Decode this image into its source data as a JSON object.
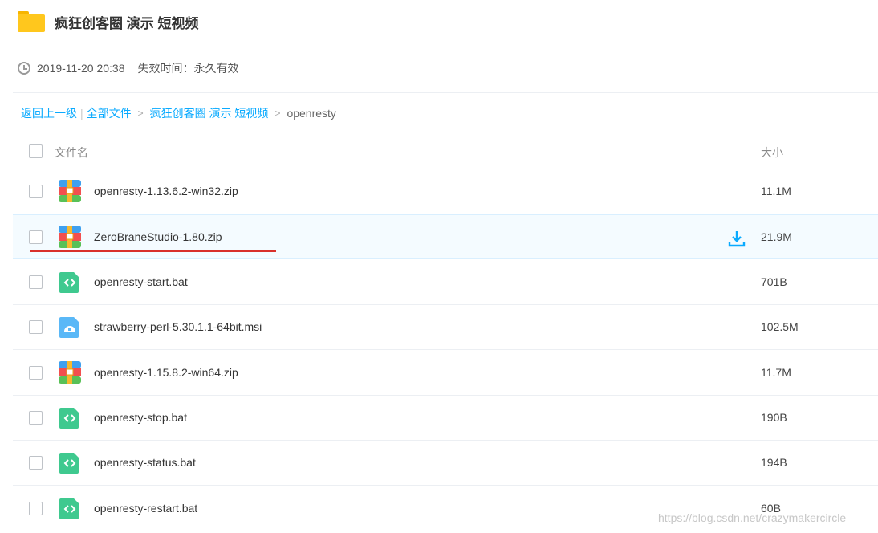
{
  "share": {
    "title": "疯狂创客圈 演示 短视频",
    "date": "2019-11-20 20:38",
    "expire": "失效时间：永久有效"
  },
  "breadcrumb": {
    "back": "返回上一级",
    "sep": "|",
    "all_files": "全部文件",
    "arrow": ">",
    "folder": "疯狂创客圈 演示 短视频",
    "current": "openresty"
  },
  "list": {
    "header_name": "文件名",
    "header_size": "大小",
    "rows": [
      {
        "name": "openresty-1.13.6.2-win32.zip",
        "size": "11.1M",
        "icon": "zip-archive-icon"
      },
      {
        "name": "ZeroBraneStudio-1.80.zip",
        "size": "21.9M",
        "icon": "zip-archive-icon"
      },
      {
        "name": "openresty-start.bat",
        "size": "701B",
        "icon": "code-file-icon"
      },
      {
        "name": "strawberry-perl-5.30.1.1-64bit.msi",
        "size": "102.5M",
        "icon": "installer-file-icon"
      },
      {
        "name": "openresty-1.15.8.2-win64.zip",
        "size": "11.7M",
        "icon": "zip-archive-icon"
      },
      {
        "name": "openresty-stop.bat",
        "size": "190B",
        "icon": "code-file-icon"
      },
      {
        "name": "openresty-status.bat",
        "size": "194B",
        "icon": "code-file-icon"
      },
      {
        "name": "openresty-restart.bat",
        "size": "60B",
        "icon": "code-file-icon"
      }
    ]
  },
  "watermark": "https://blog.csdn.net/crazymakercircle",
  "colors": {
    "link": "#09aaff",
    "folder": "#ffc71d",
    "code_file": "#3fc98f",
    "installer": "#5ab8f7",
    "highlight_underline": "#d9302b"
  }
}
